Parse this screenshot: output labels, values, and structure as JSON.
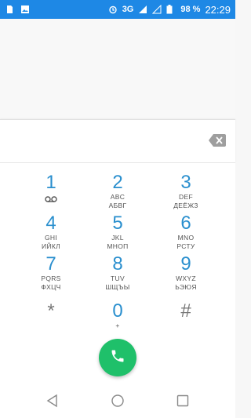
{
  "status_bar": {
    "network": "3G",
    "network_small": "3G",
    "battery": "98 %",
    "time": "22:29"
  },
  "dialer": {
    "digits_value": "",
    "backspace_icon": "backspace-icon"
  },
  "keys": [
    {
      "digit": "1",
      "latin": "",
      "cyrillic": "",
      "voicemail": true
    },
    {
      "digit": "2",
      "latin": "ABC",
      "cyrillic": "АБВГ"
    },
    {
      "digit": "3",
      "latin": "DEF",
      "cyrillic": "ДЕЁЖЗ"
    },
    {
      "digit": "4",
      "latin": "GHI",
      "cyrillic": "ИЙКЛ"
    },
    {
      "digit": "5",
      "latin": "JKL",
      "cyrillic": "МНОП"
    },
    {
      "digit": "6",
      "latin": "MNO",
      "cyrillic": "РСТУ"
    },
    {
      "digit": "7",
      "latin": "PQRS",
      "cyrillic": "ФХЦЧ"
    },
    {
      "digit": "8",
      "latin": "TUV",
      "cyrillic": "ШЩЪЫ"
    },
    {
      "digit": "9",
      "latin": "WXYZ",
      "cyrillic": "ЬЭЮЯ"
    },
    {
      "digit": "*",
      "latin": "",
      "cyrillic": ""
    },
    {
      "digit": "0",
      "latin": "+",
      "cyrillic": ""
    },
    {
      "digit": "#",
      "latin": "",
      "cyrillic": ""
    }
  ],
  "colors": {
    "status_bar": "#1e88e5",
    "digit": "#2a8fce",
    "call_button": "#1fc06a"
  }
}
